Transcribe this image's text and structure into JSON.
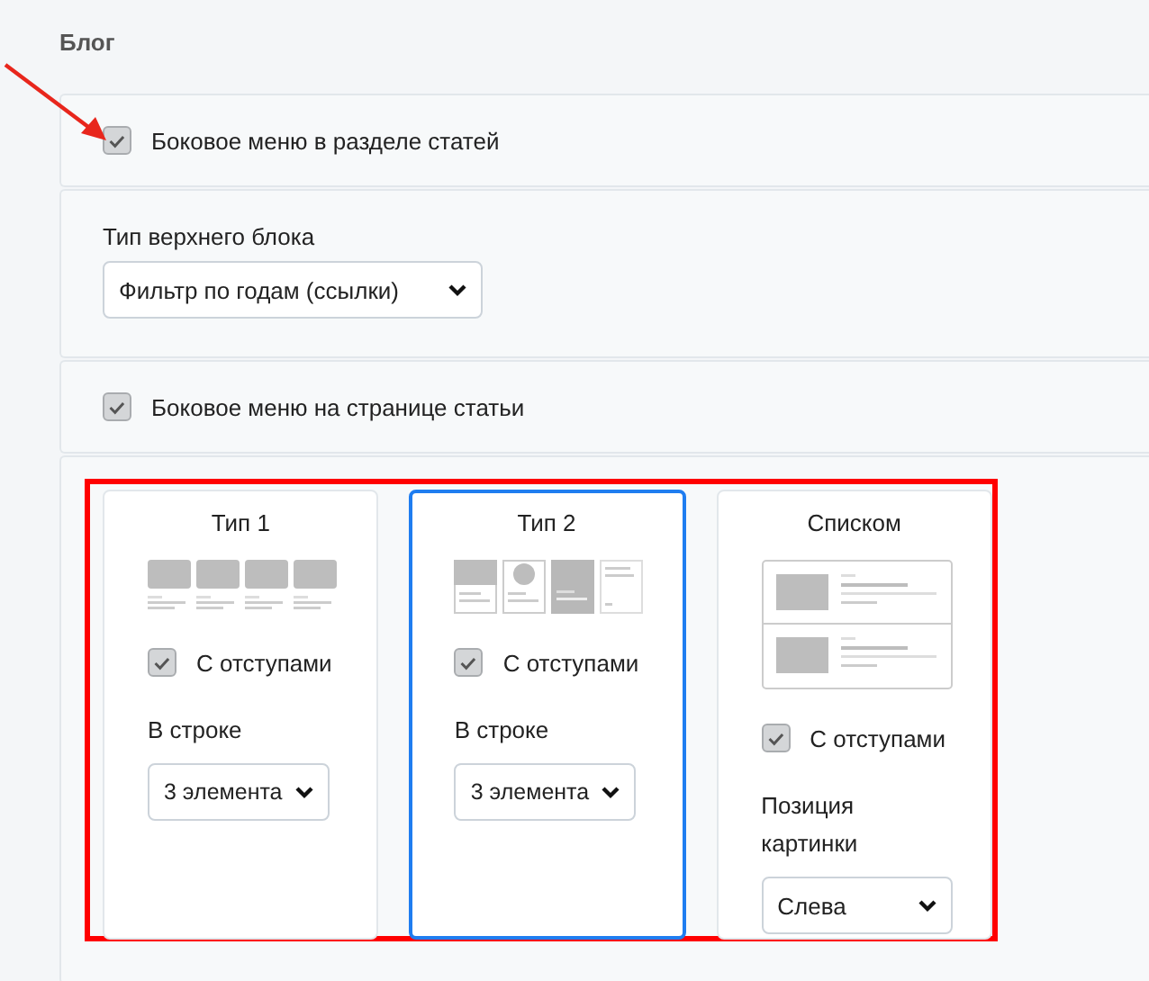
{
  "section_title": "Блог",
  "options": [
    {
      "kind": "checkbox",
      "label": "Боковое меню в разделе статей",
      "checked": true
    },
    {
      "kind": "select",
      "label": "Тип верхнего блока",
      "value": "Фильтр по годам (ссылки)"
    },
    {
      "kind": "checkbox",
      "label": "Боковое меню на странице статьи",
      "checked": true
    }
  ],
  "layouts": [
    {
      "title": "Тип 1",
      "kind": "tiles",
      "selected": false,
      "padding_label": "С отступами",
      "padding_checked": true,
      "field_label": "В строке",
      "field_value": "3 элемента"
    },
    {
      "title": "Тип 2",
      "kind": "mixed",
      "selected": true,
      "padding_label": "С отступами",
      "padding_checked": true,
      "field_label": "В строке",
      "field_value": "3 элемента"
    },
    {
      "title": "Списком",
      "kind": "list",
      "selected": false,
      "padding_label": "С отступами",
      "padding_checked": true,
      "field_label": "Позиция картинки",
      "field_value": "Слева"
    }
  ]
}
